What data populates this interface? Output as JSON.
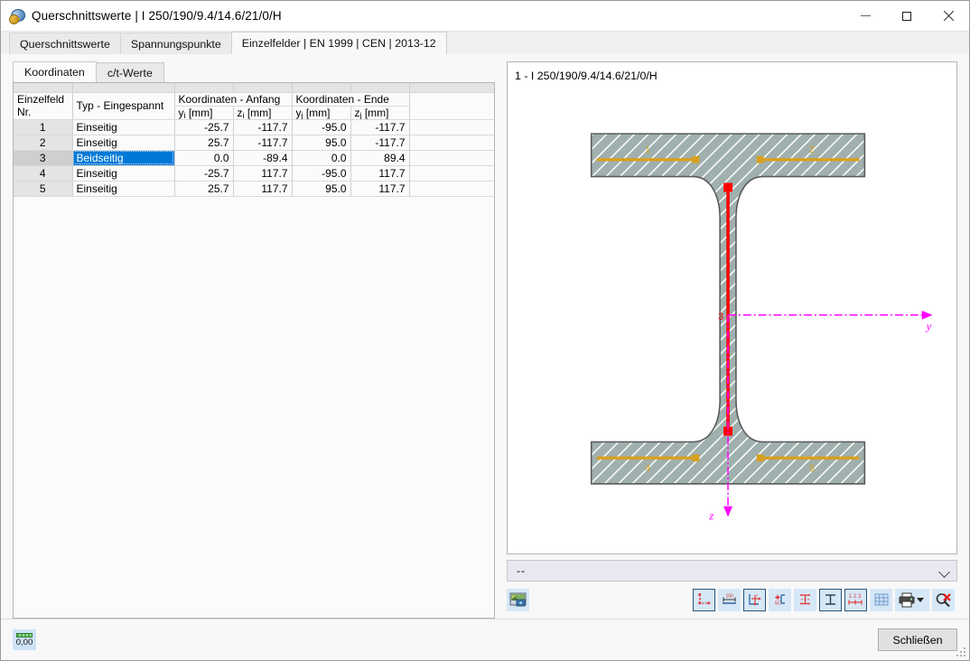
{
  "window": {
    "title": "Querschnittswerte | I 250/190/9.4/14.6/21/0/H",
    "icon": "section-properties-icon",
    "minimize": "minimize-icon",
    "maximize": "maximize-icon",
    "close": "close-icon"
  },
  "outer_tabs": [
    {
      "label": "Querschnittswerte",
      "active": false
    },
    {
      "label": "Spannungspunkte",
      "active": false
    },
    {
      "label": "Einzelfelder | EN 1999 | CEN | 2013-12",
      "active": true
    }
  ],
  "inner_tabs": [
    {
      "label": "Koordinaten",
      "active": true
    },
    {
      "label": "c/t-Werte",
      "active": false
    }
  ],
  "table": {
    "group_headers": [
      "",
      "",
      "Koordinaten - Anfang",
      "Koordinaten - Ende",
      ""
    ],
    "columns": [
      {
        "line1": "Einzelfeld",
        "line2": "Nr."
      },
      {
        "line1": "",
        "line2": "Typ - Eingespannt"
      },
      {
        "line1": "",
        "line2": "y",
        "sub": "i",
        "unit": " [mm]"
      },
      {
        "line1": "",
        "line2": "z",
        "sub": "i",
        "unit": " [mm]"
      },
      {
        "line1": "",
        "line2": "y",
        "sub": "j",
        "unit": " [mm]"
      },
      {
        "line1": "",
        "line2": "z",
        "sub": "j",
        "unit": " [mm]"
      },
      {
        "line1": "",
        "line2": ""
      }
    ],
    "rows": [
      {
        "nr": "1",
        "typ": "Einseitig",
        "yi": "-25.7",
        "zi": "-117.7",
        "yj": "-95.0",
        "zj": "-117.7",
        "selected": false
      },
      {
        "nr": "2",
        "typ": "Einseitig",
        "yi": "25.7",
        "zi": "-117.7",
        "yj": "95.0",
        "zj": "-117.7",
        "selected": false
      },
      {
        "nr": "3",
        "typ": "Beidseitig",
        "yi": "0.0",
        "zi": "-89.4",
        "yj": "0.0",
        "zj": "89.4",
        "selected": true
      },
      {
        "nr": "4",
        "typ": "Einseitig",
        "yi": "-25.7",
        "zi": "117.7",
        "yj": "-95.0",
        "zj": "117.7",
        "selected": false
      },
      {
        "nr": "5",
        "typ": "Einseitig",
        "yi": "25.7",
        "zi": "117.7",
        "yj": "95.0",
        "zj": "117.7",
        "selected": false
      }
    ]
  },
  "viewer": {
    "title": "1 - I 250/190/9.4/14.6/21/0/H",
    "axis_y_label": "y",
    "axis_z_label": "z",
    "field_labels": [
      "1",
      "2",
      "3",
      "4",
      "5"
    ],
    "selected_field": "3",
    "colors": {
      "section_fill": "#9fb0ae",
      "section_stroke": "#5a5a5a",
      "field_marker": "#d8a021",
      "selected_marker": "#ff0000",
      "axis": "#ff00ff"
    }
  },
  "combo": {
    "value": "--",
    "chevron": "chevron-down-icon"
  },
  "toolbar": {
    "image_button": "picture-icon",
    "buttons": [
      {
        "name": "section-outline-icon",
        "framed": true
      },
      {
        "name": "dimension-icon",
        "framed": false
      },
      {
        "name": "axes-icon",
        "framed": true
      },
      {
        "name": "shear-center-icon",
        "framed": false
      },
      {
        "name": "principal-axes-icon",
        "framed": false
      },
      {
        "name": "parts-icon",
        "framed": true
      },
      {
        "name": "numbering-icon",
        "framed": true
      },
      {
        "name": "grid-icon",
        "framed": false
      },
      {
        "name": "print-icon",
        "framed": false
      },
      {
        "name": "zoom-reset-icon",
        "framed": false
      }
    ]
  },
  "footer": {
    "status_value": "0,00",
    "status_icon": "units-icon",
    "close_label": "Schließen"
  }
}
